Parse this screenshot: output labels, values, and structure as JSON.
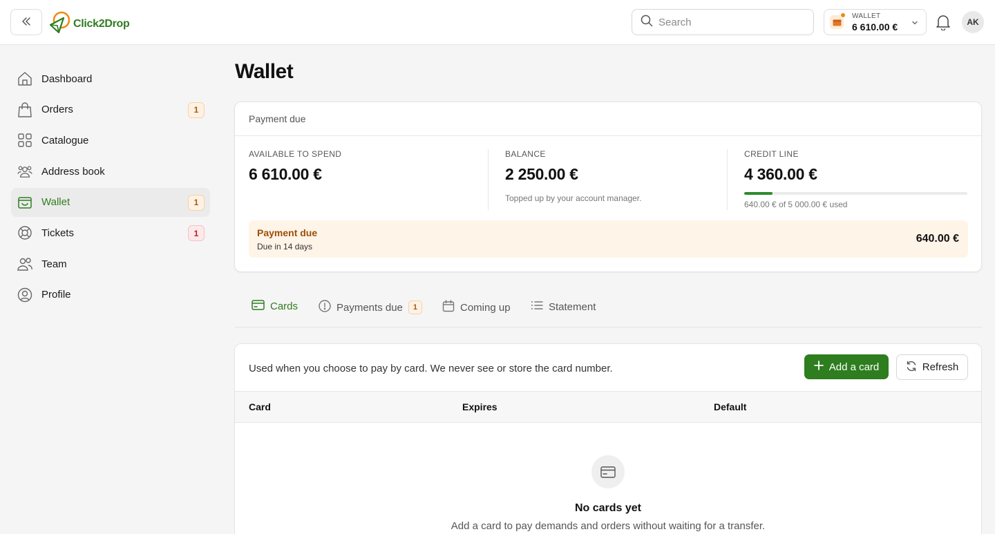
{
  "header": {
    "logo_text": "Click2Drop",
    "search_placeholder": "Search",
    "wallet_label": "WALLET",
    "wallet_amount": "6 610.00 €",
    "avatar_initials": "AK"
  },
  "sidebar": {
    "items": [
      {
        "label": "Dashboard",
        "icon": "home-icon"
      },
      {
        "label": "Orders",
        "icon": "shopping-bag-icon",
        "badge": "1"
      },
      {
        "label": "Catalogue",
        "icon": "grid-icon"
      },
      {
        "label": "Address book",
        "icon": "users-group-icon"
      },
      {
        "label": "Wallet",
        "icon": "wallet-icon",
        "badge": "1",
        "active": true
      },
      {
        "label": "Tickets",
        "icon": "lifebuoy-icon",
        "badge": "1"
      },
      {
        "label": "Team",
        "icon": "team-icon"
      },
      {
        "label": "Profile",
        "icon": "user-circle-icon"
      }
    ]
  },
  "page": {
    "title": "Wallet"
  },
  "summary": {
    "header": "Payment due",
    "available": {
      "label": "AVAILABLE TO SPEND",
      "value": "6 610.00 €"
    },
    "balance": {
      "label": "BALANCE",
      "value": "2 250.00 €",
      "note": "Topped up by your account manager."
    },
    "credit": {
      "label": "CREDIT LINE",
      "value": "4 360.00 €",
      "used_fraction": 0.128,
      "note": "640.00 € of 5 000.00 € used"
    },
    "due_banner": {
      "title": "Payment due",
      "subtitle": "Due in 14 days",
      "amount": "640.00 €"
    }
  },
  "tabs": [
    {
      "label": "Cards",
      "icon": "card-icon",
      "active": true
    },
    {
      "label": "Payments due",
      "icon": "alert-circle-icon",
      "badge": "1"
    },
    {
      "label": "Coming up",
      "icon": "calendar-icon"
    },
    {
      "label": "Statement",
      "icon": "list-icon"
    }
  ],
  "cards_panel": {
    "description": "Used when you choose to pay by card. We never see or store the card number.",
    "add_button": "Add a card",
    "refresh_button": "Refresh",
    "columns": [
      "Card",
      "Expires",
      "Default"
    ],
    "empty_title": "No cards yet",
    "empty_subtitle": "Add a card to pay demands and orders without waiting for a transfer."
  },
  "colors": {
    "brand_green": "#2e7d1f",
    "accent_orange": "#f08a12",
    "due_banner_bg": "#fff4e8"
  }
}
